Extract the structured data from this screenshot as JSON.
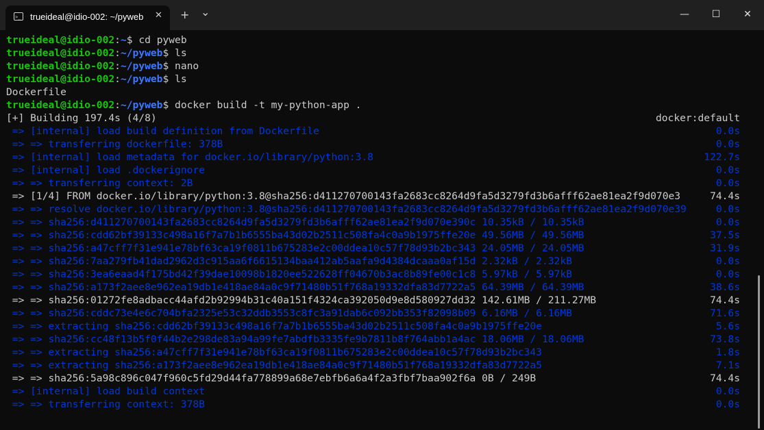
{
  "tab": {
    "title": "trueideal@idio-002: ~/pyweb",
    "icon": "terminal-icon",
    "close_glyph": "✕"
  },
  "titlebar": {
    "new_tab_glyph": "+",
    "dropdown_glyph": "⌄",
    "minimize_glyph": "—",
    "maximize_glyph": "☐",
    "close_glyph": "✕"
  },
  "colors": {
    "prompt_user": "#16c60c",
    "prompt_path": "#3b78ff",
    "text": "#cccccc",
    "progress_blue": "#0037da",
    "background": "#0c0c0c"
  },
  "prompt": {
    "user": "trueideal@idio-002",
    "sep": ":"
  },
  "commands": [
    {
      "path": "~",
      "cmd": " cd pyweb"
    },
    {
      "path": "~/pyweb",
      "cmd": " ls"
    },
    {
      "path": "~/pyweb",
      "cmd": " nano"
    },
    {
      "path": "~/pyweb",
      "cmd": " ls"
    }
  ],
  "ls_output": "Dockerfile",
  "build_command": {
    "path": "~/pyweb",
    "cmd": " docker build -t my-python-app ."
  },
  "build_header": {
    "left": "[+] Building 197.4s (4/8)",
    "right": "docker:default"
  },
  "build_lines": [
    {
      "text": " => [internal] load build definition from Dockerfile",
      "time": "0.0s",
      "style": "blue"
    },
    {
      "text": " => => transferring dockerfile: 378B",
      "time": "0.0s",
      "style": "blue"
    },
    {
      "text": " => [internal] load metadata for docker.io/library/python:3.8",
      "time": "122.7s",
      "style": "blue"
    },
    {
      "text": " => [internal] load .dockerignore",
      "time": "0.0s",
      "style": "blue"
    },
    {
      "text": " => => transferring context: 2B",
      "time": "0.0s",
      "style": "blue"
    },
    {
      "text": " => [1/4] FROM docker.io/library/python:3.8@sha256:d411270700143fa2683cc8264d9fa5d3279fd3b6afff62ae81ea2f9d070e3",
      "time": "74.4s",
      "style": "plain"
    },
    {
      "text": " => => resolve docker.io/library/python:3.8@sha256:d411270700143fa2683cc8264d9fa5d3279fd3b6afff62ae81ea2f9d070e39",
      "time": "0.0s",
      "style": "blue"
    },
    {
      "text": " => => sha256:d411270700143fa2683cc8264d9fa5d3279fd3b6afff62ae81ea2f9d070e390c 10.35kB / 10.35kB",
      "time": "0.0s",
      "style": "blue"
    },
    {
      "text": " => => sha256:cdd62bf39133c498a16f7a7b1b6555ba43d02b2511c508fa4c0a9b1975ffe20e 49.56MB / 49.56MB",
      "time": "37.5s",
      "style": "blue"
    },
    {
      "text": " => => sha256:a47cff7f31e941e78bf63ca19f0811b675283e2c00ddea10c57f78d93b2bc343 24.05MB / 24.05MB",
      "time": "31.9s",
      "style": "blue"
    },
    {
      "text": " => => sha256:7aa279fb41dad2962d3c915aa6f6615134baa412ab5aafa9d4384dcaaa0af15d 2.32kB / 2.32kB",
      "time": "0.0s",
      "style": "blue"
    },
    {
      "text": " => => sha256:3ea6eaad4f175bd42f39dae10098b1820ee522628ff04670b3ac8b89fe00c1c8 5.97kB / 5.97kB",
      "time": "0.0s",
      "style": "blue"
    },
    {
      "text": " => => sha256:a173f2aee8e962ea19db1e418ae84a0c9f71480b51f768a19332dfa83d7722a5 64.39MB / 64.39MB",
      "time": "38.6s",
      "style": "blue"
    },
    {
      "text": " => => sha256:01272fe8adbacc44afd2b92994b31c40a151f4324ca392050d9e8d580927dd32 142.61MB / 211.27MB",
      "time": "74.4s",
      "style": "plain"
    },
    {
      "text": " => => sha256:cddc73e4e6c704bfa2325e53c32ddb3553c8fc3a91dab6c092bb353f82098b09 6.16MB / 6.16MB",
      "time": "71.6s",
      "style": "blue"
    },
    {
      "text": " => => extracting sha256:cdd62bf39133c498a16f7a7b1b6555ba43d02b2511c508fa4c0a9b1975ffe20e",
      "time": "5.6s",
      "style": "blue"
    },
    {
      "text": " => => sha256:cc48f13b5f0f44b2e298de83a94a99fe7abdfb3335fe9b7811b8f764abb1a4ac 18.06MB / 18.06MB",
      "time": "73.8s",
      "style": "blue"
    },
    {
      "text": " => => extracting sha256:a47cff7f31e941e78bf63ca19f0811b675283e2c00ddea10c57f78d93b2bc343",
      "time": "1.8s",
      "style": "blue"
    },
    {
      "text": " => => extracting sha256:a173f2aee8e962ea19db1e418ae84a0c9f71480b51f768a19332dfa83d7722a5",
      "time": "7.1s",
      "style": "blue"
    },
    {
      "text": " => => sha256:5a98c896c047f960c5fd29d44fa778899a68e7ebfb6a6a4f2a3fbf7baa902f6a 0B / 249B",
      "time": "74.4s",
      "style": "plain"
    },
    {
      "text": " => [internal] load build context",
      "time": "0.0s",
      "style": "blue"
    },
    {
      "text": " => => transferring context: 378B",
      "time": "0.0s",
      "style": "blue"
    }
  ]
}
